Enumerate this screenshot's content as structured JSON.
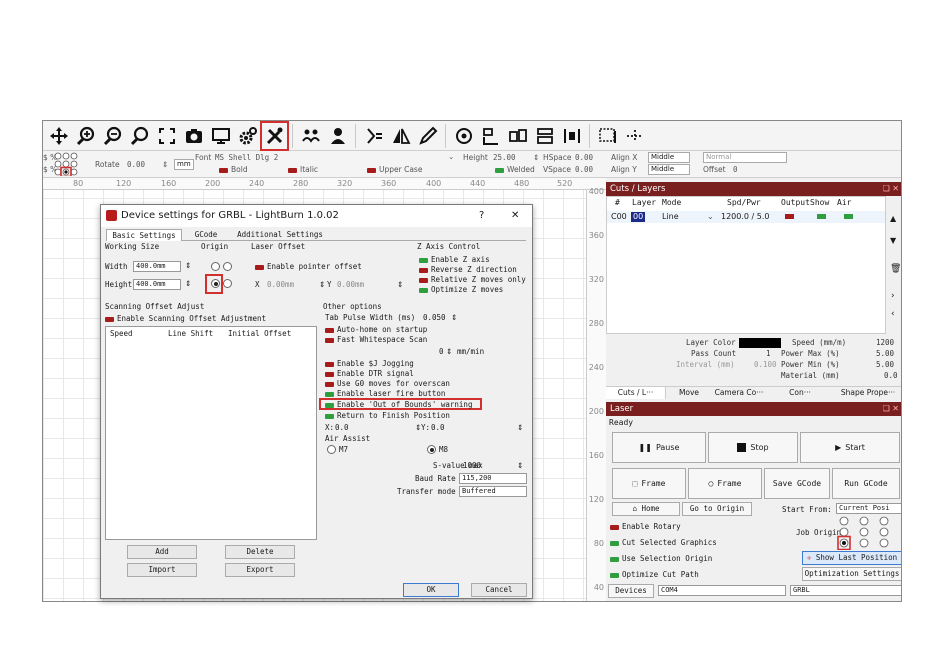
{
  "ruler_top": [
    "80",
    "120",
    "160",
    "200",
    "240",
    "280",
    "320",
    "360",
    "400",
    "440",
    "480",
    "520"
  ],
  "ruler_right": [
    "400",
    "360",
    "320",
    "280",
    "240",
    "200",
    "160",
    "120",
    "80",
    "40"
  ],
  "row2": {
    "rotate_label": "Rotate",
    "rotate_value": "0.00",
    "unit": "mm",
    "font_label": "Font",
    "font_value": "MS Shell Dlg 2",
    "height_label": "Height",
    "height_value": "25.00",
    "hspace_label": "HSpace",
    "hspace_value": "0.00",
    "align_x_label": "Align X",
    "align_x_value": "Middle",
    "mode_value": "Normal",
    "bold": "Bold",
    "italic": "Italic",
    "upper": "Upper Case",
    "welded": "Welded",
    "vspace_label": "VSpace",
    "vspace_value": "0.00",
    "align_y_label": "Align Y",
    "align_y_value": "Middle",
    "offset_label": "Offset",
    "offset_value": "0"
  },
  "cuts": {
    "title": "Cuts / Layers",
    "headers": [
      "#",
      "Layer",
      "Mode",
      "Spd/Pwr",
      "Output",
      "Show",
      "Air"
    ],
    "row": {
      "num": "C00",
      "layer": "00",
      "mode": "Line",
      "spdpwr": "1200.0 / 5.0"
    },
    "layer_color_label": "Layer Color",
    "speed_label": "Speed (mm/m)",
    "speed_value": "1200",
    "pass_label": "Pass Count",
    "pass_value": "1",
    "pmax_label": "Power Max (%)",
    "pmax_value": "5.00",
    "interval_label": "Interval (mm)",
    "interval_value": "0.100",
    "pmin_label": "Power Min (%)",
    "pmin_value": "5.00",
    "material_label": "Material (mm)",
    "material_value": "0.0",
    "tabs": [
      "Cuts / L···",
      "Move",
      "Camera Co···",
      "Con···",
      "Shape Prope···"
    ]
  },
  "laser": {
    "title": "Laser",
    "status": "Ready",
    "pause": "Pause",
    "stop": "Stop",
    "start": "Start",
    "frame1": "Frame",
    "frame2": "Frame",
    "save_gcode": "Save GCode",
    "run_gcode": "Run GCode",
    "home": "Home",
    "go_origin": "Go to Origin",
    "start_from_label": "Start From:",
    "start_from_value": "Current Posi",
    "enable_rotary": "Enable Rotary",
    "job_origin": "Job Origin",
    "cut_selected": "Cut Selected Graphics",
    "use_selection": "Use Selection Origin",
    "show_last": "Show Last Position",
    "optimize": "Optimize Cut Path",
    "opt_settings": "Optimization Settings",
    "devices_label": "Devices",
    "port": "COM4",
    "device": "GRBL"
  },
  "dialog": {
    "title": "Device settings for GRBL - LightBurn 1.0.02",
    "help": "?",
    "close": "✕",
    "tabs": [
      "Basic Settings",
      "GCode",
      "Additional Settings"
    ],
    "working_size": "Working Size",
    "width_label": "Width",
    "width_value": "400.0mm",
    "height_label": "Height",
    "height_value": "400.0mm",
    "origin": "Origin",
    "laser_offset": "Laser Offset",
    "enable_pointer": "Enable pointer offset",
    "x_label": "X",
    "x_value": "0.00mm",
    "y_label": "Y",
    "y_value": "0.00mm",
    "z_axis": "Z Axis Control",
    "enable_z": "Enable Z axis",
    "reverse_z": "Reverse Z direction",
    "relative_z": "Relative Z moves only",
    "optimize_z": "Optimize Z moves",
    "scan_offset": "Scanning Offset Adjust",
    "enable_scan": "Enable Scanning Offset Adjustment",
    "scan_headers": [
      "Speed",
      "Line Shift",
      "Initial Offset"
    ],
    "other_options": "Other options",
    "tab_pulse": "Tab Pulse Width (ms)",
    "tab_pulse_value": "0.050",
    "auto_home": "Auto-home on startup",
    "fast_ws": "Fast Whitespace Scan",
    "fast_ws_value": "0",
    "fast_ws_unit": "mm/min",
    "jog": "Enable $J Jogging",
    "dtr": "Enable DTR signal",
    "g0": "Use G0 moves for overscan",
    "fire": "Enable laser fire button",
    "oob": "Enable 'Out of Bounds' warning",
    "return": "Return to Finish Position",
    "ret_x_label": "X:",
    "ret_x": "0.0",
    "ret_y_label": "Y:",
    "ret_y": "0.0",
    "air_assist": "Air Assist",
    "m7": "M7",
    "m8": "M8",
    "svalue_label": "S-value max",
    "svalue": "1000",
    "baud_label": "Baud Rate",
    "baud": "115,200",
    "transfer_label": "Transfer mode",
    "transfer": "Buffered",
    "add": "Add",
    "delete": "Delete",
    "import": "Import",
    "export": "Export",
    "ok": "OK",
    "cancel": "Cancel"
  },
  "colors": {
    "accent": "#7a1f1f",
    "highlight": "#d32f2f",
    "toggle_on": "#2e9e3f",
    "toggle_off": "#a61c1c"
  },
  "icons": [
    "move-icon",
    "zoom-in-icon",
    "zoom-out-icon",
    "zoom-fit-icon",
    "frame-icon",
    "camera-icon",
    "monitor-icon",
    "settings-icon",
    "tools-icon",
    "users-icon",
    "user-icon",
    "mirror-icon",
    "flip-icon",
    "pen-icon",
    "target-icon",
    "align-left-icon",
    "align-center-icon",
    "align-right-icon",
    "distribute-icon",
    "grid-icon",
    "dash-icon"
  ]
}
